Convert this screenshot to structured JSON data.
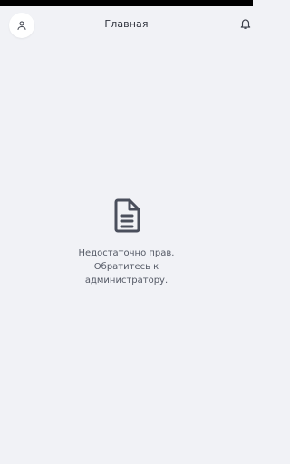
{
  "header": {
    "title": "Главная",
    "left_icon": "user-icon",
    "right_icon": "bell-icon"
  },
  "empty_state": {
    "icon": "document-icon",
    "message": "Недостаточно прав. Обратитесь к администратору."
  },
  "colors": {
    "background": "#f1f2f6",
    "icon": "#4a4f5c",
    "text": "#555a66"
  }
}
